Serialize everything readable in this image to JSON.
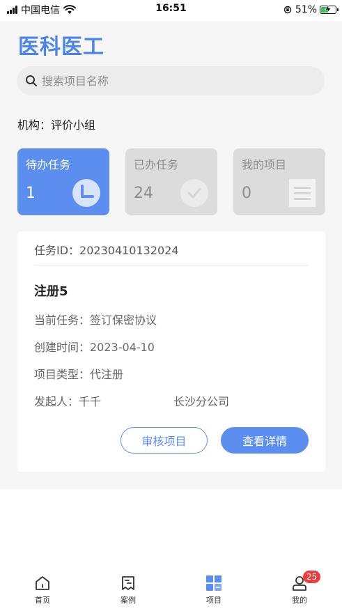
{
  "status_bar": {
    "carrier": "中国电信",
    "time": "16:51",
    "battery": "51%",
    "battery_level": 0.51
  },
  "app": {
    "title": "医科医工"
  },
  "search": {
    "placeholder": "搜索项目名称"
  },
  "org": {
    "label": "机构：评价小组"
  },
  "tiles": [
    {
      "label": "待办任务",
      "count": "1",
      "icon": "clock-icon",
      "active": true
    },
    {
      "label": "已办任务",
      "count": "24",
      "icon": "check-icon",
      "active": false
    },
    {
      "label": "我的项目",
      "count": "0",
      "icon": "document-icon",
      "active": false
    }
  ],
  "task_card": {
    "task_id": "任务ID：20230410132024",
    "project_name": "注册5",
    "current_task": "当前任务：签订保密协议",
    "created_time": "创建时间：2023-04-10",
    "project_type": "项目类型：代注册",
    "initiator": "发起人：千千",
    "company": "长沙分公司",
    "review_button": "审核项目",
    "detail_button": "查看详情"
  },
  "tabbar": {
    "items": [
      {
        "label": "首页",
        "icon": "home-icon"
      },
      {
        "label": "案例",
        "icon": "case-icon"
      },
      {
        "label": "项目",
        "icon": "grid-icon",
        "active": true
      },
      {
        "label": "我的",
        "icon": "profile-icon",
        "badge": "25"
      }
    ]
  },
  "colors": {
    "accent": "#5c8ef0",
    "title": "#4d85e6",
    "badge": "#ee3b3b",
    "tile_inactive": "#dcdcdc"
  }
}
